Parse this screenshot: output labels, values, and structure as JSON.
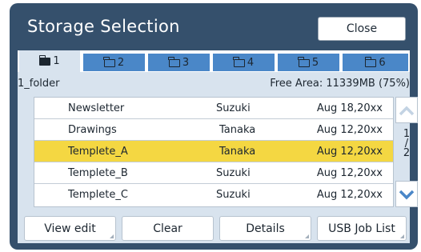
{
  "window": {
    "title": "Storage Selection",
    "close_label": "Close"
  },
  "tabs": [
    {
      "label": "1",
      "active": true
    },
    {
      "label": "2",
      "active": false
    },
    {
      "label": "3",
      "active": false
    },
    {
      "label": "4",
      "active": false
    },
    {
      "label": "5",
      "active": false
    },
    {
      "label": "6",
      "active": false
    }
  ],
  "info": {
    "folder": "1_folder",
    "free_area": "Free Area: 11339MB (75%)"
  },
  "files": [
    {
      "name": "Newsletter",
      "owner": "Suzuki",
      "date": "Aug 18,20xx",
      "selected": false
    },
    {
      "name": "Drawings",
      "owner": "Tanaka",
      "date": "Aug 12,20xx",
      "selected": false
    },
    {
      "name": "Templete_A",
      "owner": "Tanaka",
      "date": "Aug 12,20xx",
      "selected": true
    },
    {
      "name": "Templete_B",
      "owner": "Suzuki",
      "date": "Aug 12,20xx",
      "selected": false
    },
    {
      "name": "Templete_C",
      "owner": "Suzuki",
      "date": "Aug 12,20xx",
      "selected": false
    }
  ],
  "pager": {
    "current": "1",
    "separator": "/",
    "total": "2"
  },
  "buttons": {
    "view_edit": "View edit",
    "clear": "Clear",
    "details": "Details",
    "usb_job_list": "USB Job List"
  },
  "colors": {
    "frame": "#35506c",
    "tab": "#4a87c8",
    "panel": "#d8e3ee",
    "selected_row": "#f4d742",
    "scroll_arrow": "#7fa6d0"
  },
  "icons": {
    "tab": "folder-icon",
    "scroll_up": "chevron-up-icon",
    "scroll_down": "chevron-down-icon"
  }
}
